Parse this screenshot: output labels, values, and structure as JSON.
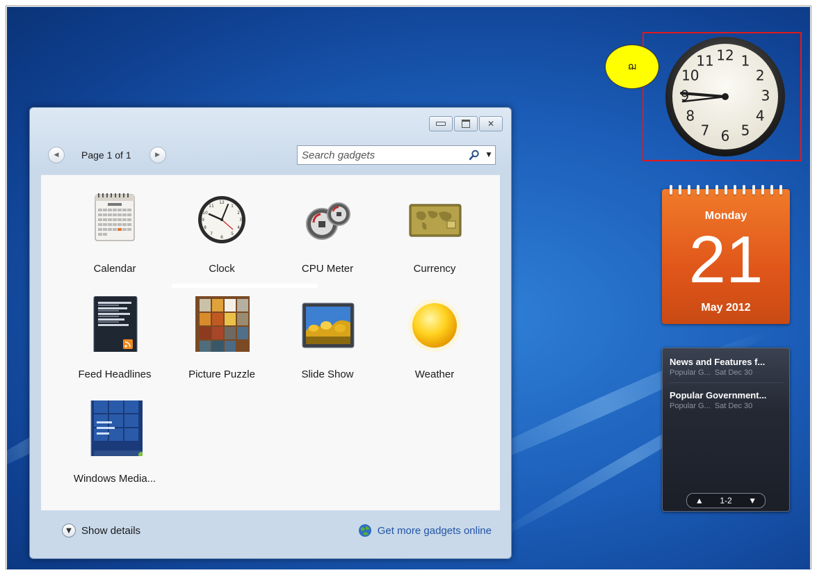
{
  "gallery": {
    "pager": {
      "label": "Page 1 of 1"
    },
    "search": {
      "placeholder": "Search gadgets"
    },
    "gadgets": [
      {
        "label": "Calendar",
        "icon": "calendar-icon"
      },
      {
        "label": "Clock",
        "icon": "clock-icon"
      },
      {
        "label": "CPU Meter",
        "icon": "cpu-meter-icon"
      },
      {
        "label": "Currency",
        "icon": "currency-icon"
      },
      {
        "label": "Feed Headlines",
        "icon": "feed-headlines-icon"
      },
      {
        "label": "Picture Puzzle",
        "icon": "picture-puzzle-icon"
      },
      {
        "label": "Slide Show",
        "icon": "slide-show-icon"
      },
      {
        "label": "Weather",
        "icon": "weather-icon"
      },
      {
        "label": "Windows Media...",
        "icon": "windows-media-icon"
      }
    ],
    "footer": {
      "show_details": "Show details",
      "get_more": "Get more gadgets online"
    }
  },
  "annotation": {
    "marker": "ฌ"
  },
  "clock_gadget": {
    "numbers": [
      "12",
      "1",
      "2",
      "3",
      "4",
      "5",
      "6",
      "7",
      "8",
      "9",
      "10",
      "11"
    ]
  },
  "calendar_gadget": {
    "day": "Monday",
    "date": "21",
    "month_year": "May 2012"
  },
  "feed_gadget": {
    "items": [
      {
        "title": "News and Features f...",
        "source": "Popular G...",
        "date": "Sat Dec 30"
      },
      {
        "title": "Popular Government...",
        "source": "Popular G...",
        "date": "Sat Dec 30"
      }
    ],
    "pager": "1-2"
  },
  "colors": {
    "desktop": "#1b5db8",
    "calendar": "#e0561a",
    "highlight_box": "#e1191b",
    "marker": "#ffff00"
  }
}
